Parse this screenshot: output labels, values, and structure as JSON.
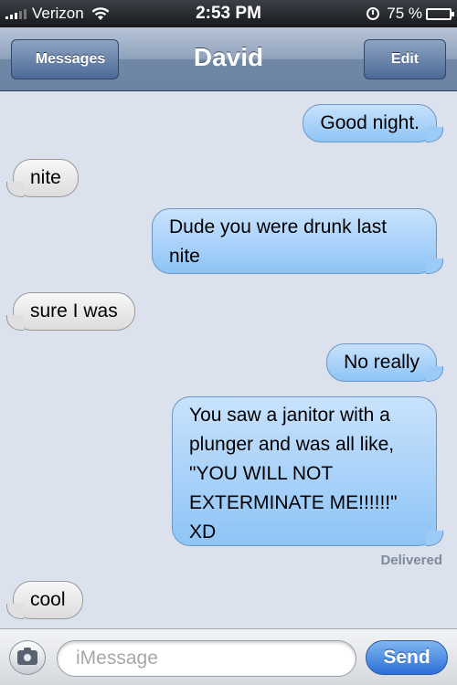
{
  "status_bar": {
    "carrier": "Verizon",
    "time": "2:53 PM",
    "battery": "75 %",
    "battery_level": 0.75,
    "icons": [
      "signal-icon",
      "wifi-icon",
      "clock-icon",
      "battery-icon"
    ]
  },
  "nav": {
    "back_label": "Messages",
    "title": "David",
    "edit_label": "Edit"
  },
  "messages": [
    {
      "from": "me",
      "text": "Good night."
    },
    {
      "from": "them",
      "text": "nite"
    },
    {
      "from": "me",
      "text": "Dude you were drunk last nite"
    },
    {
      "from": "them",
      "text": "sure I was"
    },
    {
      "from": "me",
      "text": "No really"
    },
    {
      "from": "me",
      "text": "You saw a janitor with a plunger and was all like, \"YOU WILL NOT EXTERMINATE ME!!!!!!\" XD"
    },
    {
      "from": "them",
      "text": "cool"
    }
  ],
  "delivered_label": "Delivered",
  "input": {
    "placeholder": "iMessage",
    "value": "",
    "send_label": "Send"
  },
  "colors": {
    "sent_bubble": "#9ccbf7",
    "received_bubble": "#e0e0e0",
    "nav_bar": "#7187a6",
    "send_button": "#2d6fd6"
  }
}
